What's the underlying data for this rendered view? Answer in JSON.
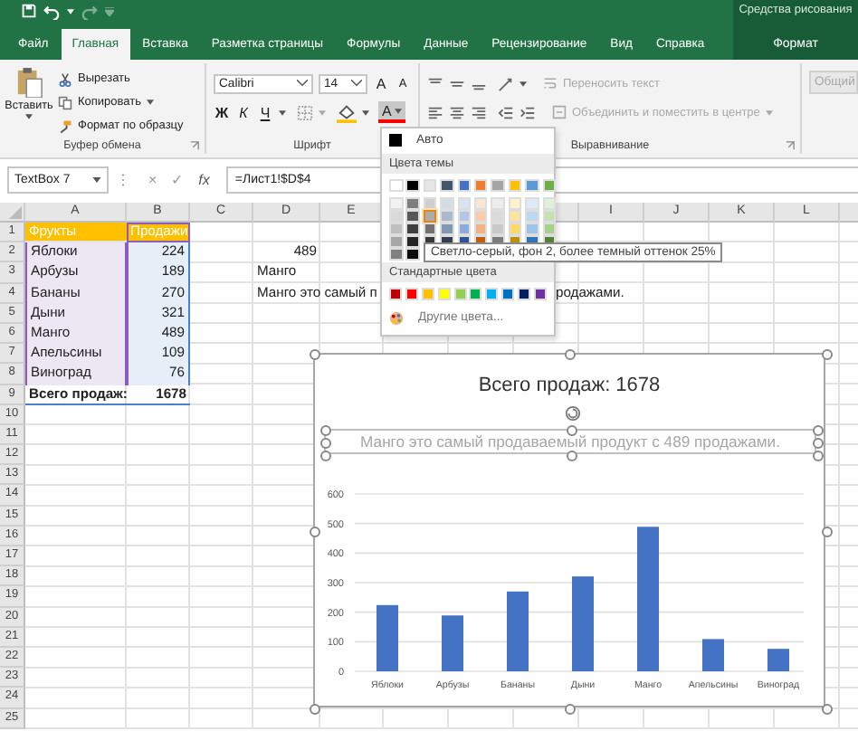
{
  "title_bar": {
    "context_title": "Средства рисования"
  },
  "tabs": [
    {
      "label": "Файл",
      "selected": false,
      "kind": "normal"
    },
    {
      "label": "Главная",
      "selected": true,
      "kind": "normal"
    },
    {
      "label": "Вставка",
      "selected": false,
      "kind": "normal"
    },
    {
      "label": "Разметка страницы",
      "selected": false,
      "kind": "normal"
    },
    {
      "label": "Формулы",
      "selected": false,
      "kind": "normal"
    },
    {
      "label": "Данные",
      "selected": false,
      "kind": "normal"
    },
    {
      "label": "Рецензирование",
      "selected": false,
      "kind": "normal"
    },
    {
      "label": "Вид",
      "selected": false,
      "kind": "normal"
    },
    {
      "label": "Справка",
      "selected": false,
      "kind": "normal"
    },
    {
      "label": "Формат",
      "selected": false,
      "kind": "context"
    }
  ],
  "clipboard": {
    "paste": "Вставить",
    "cut": "Вырезать",
    "copy": "Копировать",
    "format_painter": "Формат по образцу",
    "label": "Буфер обмена"
  },
  "font": {
    "name": "Calibri",
    "size": "14",
    "grow": "A",
    "shrink": "A",
    "bold": "Ж",
    "italic": "К",
    "underline": "Ч",
    "color_button": "A",
    "color_pressed": true,
    "label": "Шрифт"
  },
  "alignment": {
    "wrap": "Переносить текст",
    "merge": "Объединить и поместить в центре",
    "disabled": true,
    "label": "Выравнивание"
  },
  "number": {
    "format": "Общий",
    "disabled": true
  },
  "formula_bar": {
    "name_box": "TextBox 7",
    "cancel": "×",
    "enter": "✓",
    "fx": "fx",
    "formula": "=Лист1!$D$4"
  },
  "sheet": {
    "columns_left": [
      "A",
      "B",
      "C",
      "D",
      "E"
    ],
    "columns_right": [
      "I",
      "J",
      "K",
      "L"
    ],
    "rows": [
      {
        "number": "1",
        "kind": "header",
        "fruit": "Фрукты",
        "sales": "Продажи"
      },
      {
        "number": "2",
        "kind": "item",
        "fruit": "Яблоки",
        "sales": "224",
        "d": "489"
      },
      {
        "number": "3",
        "kind": "item",
        "fruit": "Арбузы",
        "sales": "189",
        "d": "Манго"
      },
      {
        "number": "4",
        "kind": "item",
        "fruit": "Бананы",
        "sales": "270",
        "d": "Манго это самый п",
        "h": "родажами."
      },
      {
        "number": "5",
        "kind": "item",
        "fruit": "Дыни",
        "sales": "321"
      },
      {
        "number": "6",
        "kind": "item",
        "fruit": "Манго",
        "sales": "489"
      },
      {
        "number": "7",
        "kind": "item",
        "fruit": "Апельсины",
        "sales": "109"
      },
      {
        "number": "8",
        "kind": "item",
        "fruit": "Виноград",
        "sales": "76"
      },
      {
        "number": "9",
        "kind": "total",
        "fruit": "Всего продаж:",
        "sales": "1678"
      },
      {
        "number": "10",
        "kind": "empty"
      },
      {
        "number": "11",
        "kind": "empty"
      },
      {
        "number": "12",
        "kind": "empty"
      },
      {
        "number": "13",
        "kind": "empty"
      },
      {
        "number": "14",
        "kind": "empty"
      },
      {
        "number": "15",
        "kind": "empty"
      },
      {
        "number": "16",
        "kind": "empty"
      },
      {
        "number": "17",
        "kind": "empty"
      },
      {
        "number": "18",
        "kind": "empty"
      },
      {
        "number": "19",
        "kind": "empty"
      },
      {
        "number": "20",
        "kind": "empty"
      },
      {
        "number": "21",
        "kind": "empty"
      },
      {
        "number": "22",
        "kind": "empty"
      },
      {
        "number": "23",
        "kind": "empty"
      },
      {
        "number": "24",
        "kind": "empty"
      },
      {
        "number": "25",
        "kind": "empty"
      }
    ]
  },
  "chart": {
    "subtitle": "Манго это самый продаваемый продукт с 489 продажами.",
    "chart_data": {
      "type": "bar",
      "grid": true,
      "title": "Всего продаж: 1678",
      "categories": [
        "Яблоки",
        "Арбузы",
        "Бананы",
        "Дыни",
        "Манго",
        "Апельсины",
        "Виноград"
      ],
      "ylim": [
        0,
        600
      ],
      "yticks": [
        0,
        100,
        200,
        300,
        400,
        500,
        600
      ],
      "series": [
        {
          "color": "#4472c4",
          "values": [
            224,
            189,
            270,
            321,
            489,
            109,
            76
          ]
        }
      ]
    }
  },
  "color_menu": {
    "auto": "Авто",
    "theme_header": "Цвета темы",
    "theme_colors": [
      {
        "color": "#ffffff",
        "selected": false,
        "shades": [
          {
            "color": "#f2f2f2",
            "selected": false
          },
          {
            "color": "#d9d9d9",
            "selected": false
          },
          {
            "color": "#bfbfbf",
            "selected": false
          },
          {
            "color": "#a6a6a6",
            "selected": false
          },
          {
            "color": "#808080",
            "selected": false
          }
        ]
      },
      {
        "color": "#000000",
        "selected": false,
        "shades": [
          {
            "color": "#7f7f7f",
            "selected": false
          },
          {
            "color": "#595959",
            "selected": false
          },
          {
            "color": "#404040",
            "selected": false
          },
          {
            "color": "#262626",
            "selected": false
          },
          {
            "color": "#0d0d0d",
            "selected": false
          }
        ]
      },
      {
        "color": "#e7e6e6",
        "selected": false,
        "shades": [
          {
            "color": "#d0cece",
            "selected": false
          },
          {
            "color": "#aeabab",
            "selected": true
          },
          {
            "color": "#757171",
            "selected": false
          },
          {
            "color": "#3a3838",
            "selected": false
          }
        ]
      },
      {
        "color": "#44546a",
        "selected": false,
        "shades": [
          {
            "color": "#d6dce4",
            "selected": false
          },
          {
            "color": "#adb9ca",
            "selected": false
          },
          {
            "color": "#8497b0",
            "selected": false
          },
          {
            "color": "#333f4f",
            "selected": false
          }
        ]
      },
      {
        "color": "#4472c4",
        "selected": false,
        "shades": [
          {
            "color": "#d9e2f3",
            "selected": false
          },
          {
            "color": "#b4c6e7",
            "selected": false
          },
          {
            "color": "#8eaadb",
            "selected": false
          },
          {
            "color": "#2f5496",
            "selected": false
          }
        ]
      },
      {
        "color": "#ed7d31",
        "selected": false,
        "shades": [
          {
            "color": "#fbe5d5",
            "selected": false
          },
          {
            "color": "#f7cbac",
            "selected": false
          },
          {
            "color": "#f4b183",
            "selected": false
          },
          {
            "color": "#c55a11",
            "selected": false
          }
        ]
      },
      {
        "color": "#a5a5a5",
        "selected": false,
        "shades": [
          {
            "color": "#ededed",
            "selected": false
          },
          {
            "color": "#dbdbdb",
            "selected": false
          },
          {
            "color": "#c9c9c9",
            "selected": false
          },
          {
            "color": "#7b7b7b",
            "selected": false
          }
        ]
      },
      {
        "color": "#ffc000",
        "selected": false,
        "shades": [
          {
            "color": "#fff2cc",
            "selected": false
          },
          {
            "color": "#fee599",
            "selected": false
          },
          {
            "color": "#ffd965",
            "selected": false
          },
          {
            "color": "#bf9000",
            "selected": false
          }
        ]
      },
      {
        "color": "#5b9bd5",
        "selected": false,
        "shades": [
          {
            "color": "#deebf6",
            "selected": false
          },
          {
            "color": "#bdd7ee",
            "selected": false
          },
          {
            "color": "#9dc3e6",
            "selected": false
          },
          {
            "color": "#2e75b5",
            "selected": false
          }
        ]
      },
      {
        "color": "#70ad47",
        "selected": false,
        "shades": [
          {
            "color": "#e2efd9",
            "selected": false
          },
          {
            "color": "#c5e0b3",
            "selected": false
          },
          {
            "color": "#a8d08d",
            "selected": false
          },
          {
            "color": "#538135",
            "selected": false
          }
        ]
      }
    ],
    "standard_header": "Стандартные цвета",
    "standard_colors": [
      {
        "color": "#c00000",
        "selected": false
      },
      {
        "color": "#ff0000",
        "selected": false
      },
      {
        "color": "#ffc000",
        "selected": false
      },
      {
        "color": "#ffff00",
        "selected": false
      },
      {
        "color": "#92d050",
        "selected": false
      },
      {
        "color": "#00b050",
        "selected": false
      },
      {
        "color": "#00b0f0",
        "selected": false
      },
      {
        "color": "#0070c0",
        "selected": false
      },
      {
        "color": "#002060",
        "selected": false
      },
      {
        "color": "#7030a0",
        "selected": false
      }
    ],
    "more": "Другие цвета..."
  },
  "tooltip": "Светло-серый, фон 2, более темный оттенок 25%"
}
